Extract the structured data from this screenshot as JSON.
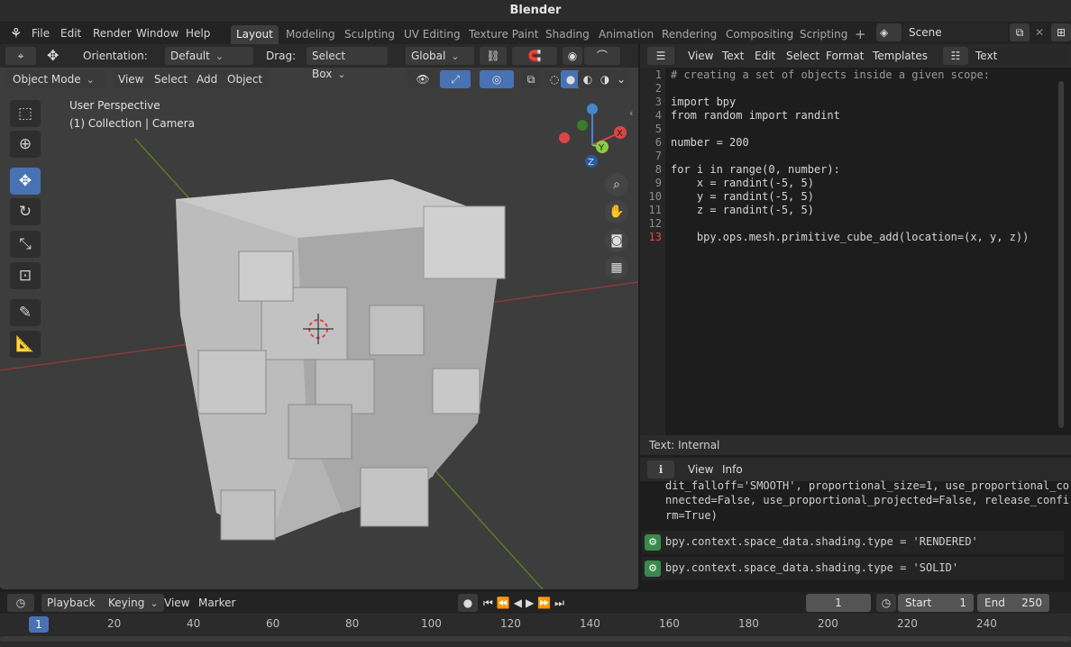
{
  "app_title": "Blender",
  "menu": [
    "File",
    "Edit",
    "Render",
    "Window",
    "Help"
  ],
  "workspaces": [
    "Layout",
    "Modeling",
    "Sculpting",
    "UV Editing",
    "Texture Paint",
    "Shading",
    "Animation",
    "Rendering",
    "Compositing",
    "Scripting"
  ],
  "active_workspace": "Layout",
  "scene_name": "Scene",
  "viewport": {
    "orientation_label": "Orientation:",
    "orientation_value": "Default",
    "drag_label": "Drag:",
    "drag_value": "Select Box",
    "transform_orientation": "Global",
    "mode": "Object Mode",
    "menus": [
      "View",
      "Select",
      "Add",
      "Object"
    ],
    "overlay_line1": "User Perspective",
    "overlay_line2": "(1) Collection | Camera",
    "gizmo": {
      "x": "X",
      "y": "Y",
      "z": "Z"
    }
  },
  "text_editor": {
    "menus": [
      "View",
      "Text",
      "Edit",
      "Select",
      "Format",
      "Templates"
    ],
    "datablock": "Text",
    "lines": [
      "# creating a set of objects inside a given scope:",
      "",
      "import bpy",
      "from random import randint",
      "",
      "number = 200",
      "",
      "for i in range(0, number):",
      "    x = randint(-5, 5)",
      "    y = randint(-5, 5)",
      "    z = randint(-5, 5)",
      "",
      "    bpy.ops.mesh.primitive_cube_add(location=(x, y, z))"
    ],
    "footer": "Text: Internal"
  },
  "info": {
    "menus": [
      "View",
      "Info"
    ],
    "log_text": [
      "dit_falloff='SMOOTH', proportional_size=1, use_proportional_co",
      "nnected=False, use_proportional_projected=False, release_confi",
      "rm=True)"
    ],
    "entries": [
      "bpy.context.space_data.shading.type = 'RENDERED'",
      "bpy.context.space_data.shading.type = 'SOLID'"
    ]
  },
  "timeline": {
    "menus": [
      "Playback",
      "Keying",
      "View",
      "Marker"
    ],
    "current_frame": "1",
    "start_label": "Start",
    "start": "1",
    "end_label": "End",
    "end": "250",
    "ticks": [
      "1",
      "20",
      "40",
      "60",
      "80",
      "100",
      "120",
      "140",
      "160",
      "180",
      "200",
      "220",
      "240"
    ]
  }
}
